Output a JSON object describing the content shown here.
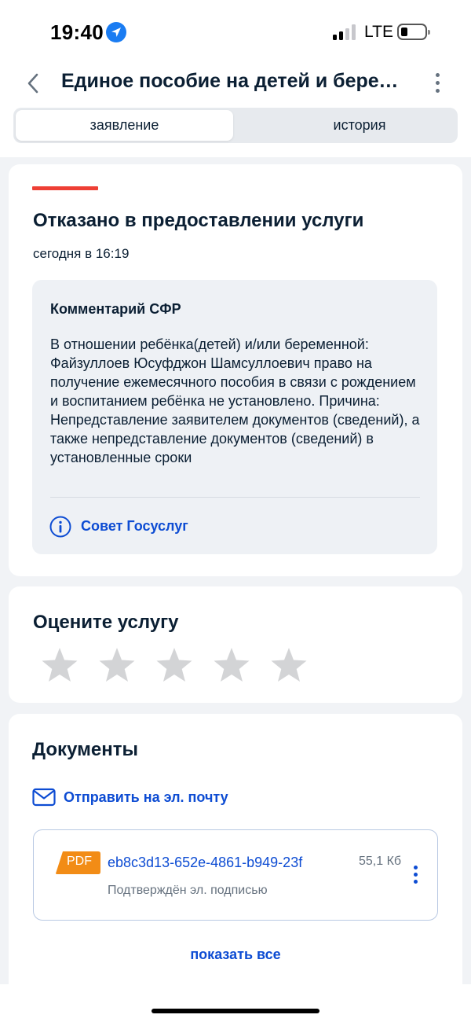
{
  "status_bar": {
    "time": "19:40",
    "network": "LTE",
    "signal_bars_active": 2,
    "signal_bars_total": 4,
    "icons": [
      "location-arrow-icon",
      "signal-icon",
      "battery-icon"
    ]
  },
  "header": {
    "title": "Единое пособие на детей и беременным",
    "icons": [
      "back-icon",
      "more-vertical-icon"
    ]
  },
  "tabs": [
    {
      "label": "заявление",
      "active": true
    },
    {
      "label": "история",
      "active": false
    }
  ],
  "status": {
    "title": "Отказано в предоставлении услуги",
    "date": "сегодня в 16:19",
    "accent_color": "#ee3f35"
  },
  "comment": {
    "title": "Комментарий СФР",
    "text": "В отношении ребёнка(детей) и/или беременной: Файзуллоев Юсуфджон Шамсуллоевич право на получение ежемесячного пособия в связи с рождением и воспитанием ребёнка не установлено. Причина: Непредставление заявителем документов (сведений), а также непредставление документов (сведений) в установленные сроки",
    "advice_link": "Совет Госуслуг",
    "advice_icon": "info-icon"
  },
  "rating": {
    "title": "Оцените услугу",
    "stars_total": 5,
    "stars_selected": 0
  },
  "documents": {
    "title": "Документы",
    "send_email_label": "Отправить на эл. почту",
    "send_email_icon": "mail-icon",
    "items": [
      {
        "badge": "PDF",
        "name": "eb8c3d13-652e-4861-b949-23f",
        "size": "55,1 Кб",
        "signature": "Подтверждён эл. подписью"
      }
    ],
    "show_all_label": "показать все"
  },
  "colors": {
    "link": "#0d4cd3",
    "text": "#0b1f33",
    "muted": "#66727f",
    "pdf_badge": "#f28c16",
    "star": "#d3d4d6",
    "page_bg": "#f1f3f6"
  }
}
